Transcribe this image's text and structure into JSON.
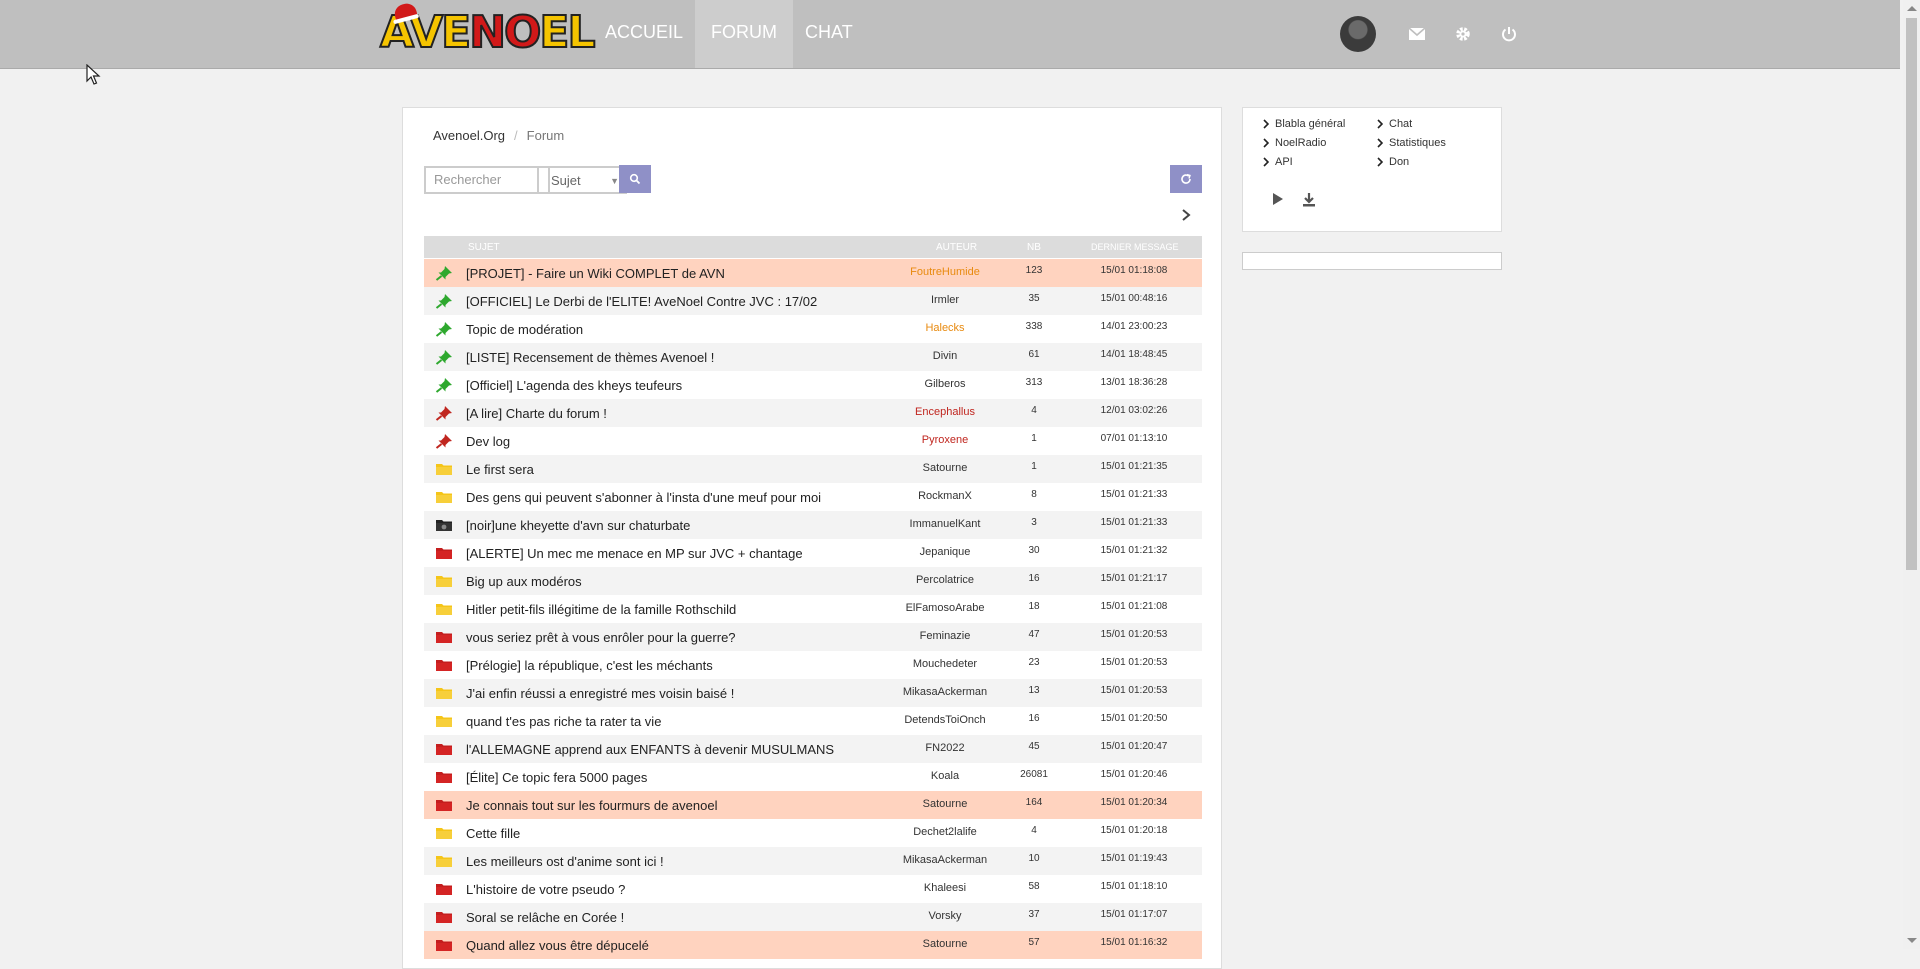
{
  "header": {
    "logo_text": "AVENOEL",
    "nav": [
      {
        "label": "ACCUEIL",
        "active": false
      },
      {
        "label": "FORUM",
        "active": true
      },
      {
        "label": "CHAT",
        "active": false
      }
    ],
    "icons": [
      "avatar",
      "mail-icon",
      "gear-icon",
      "power-icon"
    ]
  },
  "breadcrumb": {
    "home": "Avenoel.Org",
    "separator": "/",
    "current": "Forum"
  },
  "search": {
    "placeholder": "Rechercher",
    "select_value": "Sujet"
  },
  "table": {
    "headers": {
      "subject": "SUJET",
      "author": "AUTEUR",
      "nb": "NB",
      "last": "DERNIER MESSAGE"
    },
    "rows": [
      {
        "icon": "pin-green",
        "title": "[PROJET] - Faire un Wiki COMPLET de AVN",
        "author": "FoutreHumide",
        "author_type": "mod",
        "nb": "123",
        "date": "15/01 01:18:08",
        "style": "hl"
      },
      {
        "icon": "pin-green",
        "title": "[OFFICIEL] Le Derbi de l'ELITE! AveNoel Contre JVC : 17/02",
        "author": "Irmler",
        "author_type": "user",
        "nb": "35",
        "date": "15/01 00:48:16",
        "style": "alt"
      },
      {
        "icon": "pin-green",
        "title": "Topic de modération",
        "author": "Halecks",
        "author_type": "mod",
        "nb": "338",
        "date": "14/01 23:00:23",
        "style": ""
      },
      {
        "icon": "pin-green",
        "title": "[LISTE] Recensement de thèmes Avenoel !",
        "author": "Divin",
        "author_type": "user",
        "nb": "61",
        "date": "14/01 18:48:45",
        "style": "alt"
      },
      {
        "icon": "pin-green",
        "title": "[Officiel] L'agenda des kheys teufeurs",
        "author": "Gilberos",
        "author_type": "user",
        "nb": "313",
        "date": "13/01 18:36:28",
        "style": ""
      },
      {
        "icon": "pin-red",
        "title": "[A lire] Charte du forum !",
        "author": "Encephallus",
        "author_type": "adm",
        "nb": "4",
        "date": "12/01 03:02:26",
        "style": "alt"
      },
      {
        "icon": "pin-red",
        "title": "Dev log",
        "author": "Pyroxene",
        "author_type": "adm",
        "nb": "1",
        "date": "07/01 01:13:10",
        "style": ""
      },
      {
        "icon": "folder-yellow",
        "title": "Le first sera",
        "author": "Satourne",
        "author_type": "user",
        "nb": "1",
        "date": "15/01 01:21:35",
        "style": "alt"
      },
      {
        "icon": "folder-yellow",
        "title": "Des gens qui peuvent s'abonner à l'insta d'une meuf pour moi",
        "author": "RockmanX",
        "author_type": "user",
        "nb": "8",
        "date": "15/01 01:21:33",
        "style": ""
      },
      {
        "icon": "folder-black",
        "title": "[noir]une kheyette d'avn sur chaturbate",
        "author": "ImmanuelKant",
        "author_type": "user",
        "nb": "3",
        "date": "15/01 01:21:33",
        "style": "alt"
      },
      {
        "icon": "folder-red",
        "title": "[ALERTE] Un mec me menace en MP sur JVC + chantage",
        "author": "Jepanique",
        "author_type": "user",
        "nb": "30",
        "date": "15/01 01:21:32",
        "style": ""
      },
      {
        "icon": "folder-yellow",
        "title": "Big up aux modéros",
        "author": "Percolatrice",
        "author_type": "user",
        "nb": "16",
        "date": "15/01 01:21:17",
        "style": "alt"
      },
      {
        "icon": "folder-yellow",
        "title": "Hitler petit-fils illégitime de la famille Rothschild",
        "author": "ElFamosoArabe",
        "author_type": "user",
        "nb": "18",
        "date": "15/01 01:21:08",
        "style": ""
      },
      {
        "icon": "folder-red",
        "title": "vous seriez prêt à vous enrôler pour la guerre?",
        "author": "Feminazie",
        "author_type": "user",
        "nb": "47",
        "date": "15/01 01:20:53",
        "style": "alt"
      },
      {
        "icon": "folder-red",
        "title": "[Prélogie] la république, c'est les méchants",
        "author": "Mouchedeter",
        "author_type": "user",
        "nb": "23",
        "date": "15/01 01:20:53",
        "style": ""
      },
      {
        "icon": "folder-yellow",
        "title": "J'ai enfin réussi a enregistré mes voisin baisé !",
        "author": "MikasaAckerman",
        "author_type": "user",
        "nb": "13",
        "date": "15/01 01:20:53",
        "style": "alt"
      },
      {
        "icon": "folder-yellow",
        "title": "quand t'es pas riche ta rater ta vie",
        "author": "DetendsToiOnch",
        "author_type": "user",
        "nb": "16",
        "date": "15/01 01:20:50",
        "style": ""
      },
      {
        "icon": "folder-red",
        "title": "l'ALLEMAGNE apprend aux ENFANTS à devenir MUSULMANS",
        "author": "FN2022",
        "author_type": "user",
        "nb": "45",
        "date": "15/01 01:20:47",
        "style": "alt"
      },
      {
        "icon": "folder-red",
        "title": "[Élite] Ce topic fera 5000 pages",
        "author": "Koala",
        "author_type": "user",
        "nb": "26081",
        "date": "15/01 01:20:46",
        "style": ""
      },
      {
        "icon": "folder-red",
        "title": "Je connais tout sur les fourmurs de avenoel",
        "author": "Satourne",
        "author_type": "user",
        "nb": "164",
        "date": "15/01 01:20:34",
        "style": "hl"
      },
      {
        "icon": "folder-yellow",
        "title": "Cette fille",
        "author": "Dechet2lalife",
        "author_type": "user",
        "nb": "4",
        "date": "15/01 01:20:18",
        "style": ""
      },
      {
        "icon": "folder-yellow",
        "title": "Les meilleurs ost d'anime sont ici !",
        "author": "MikasaAckerman",
        "author_type": "user",
        "nb": "10",
        "date": "15/01 01:19:43",
        "style": "alt"
      },
      {
        "icon": "folder-red",
        "title": "L'histoire de votre pseudo ?",
        "author": "Khaleesi",
        "author_type": "user",
        "nb": "58",
        "date": "15/01 01:18:10",
        "style": ""
      },
      {
        "icon": "folder-red",
        "title": "Soral se relâche en Corée !",
        "author": "Vorsky",
        "author_type": "user",
        "nb": "37",
        "date": "15/01 01:17:07",
        "style": "alt"
      },
      {
        "icon": "folder-red",
        "title": "Quand allez vous être dépucelé",
        "author": "Satourne",
        "author_type": "user",
        "nb": "57",
        "date": "15/01 01:16:32",
        "style": "hl"
      }
    ]
  },
  "sidebar": {
    "links": [
      "Blabla général",
      "Chat",
      "NoelRadio",
      "Statistiques",
      "API",
      "Don"
    ]
  },
  "colors": {
    "topbar": "#bfbfbf",
    "accent": "#8f90c7",
    "highlight_row": "#ffd3bf",
    "mod": "#e88a0f",
    "admin": "#c0261f",
    "pin_green": "#2ea82e",
    "pin_red": "#c0261f",
    "folder_yellow": "#f5c518",
    "folder_red": "#c41e1e"
  }
}
